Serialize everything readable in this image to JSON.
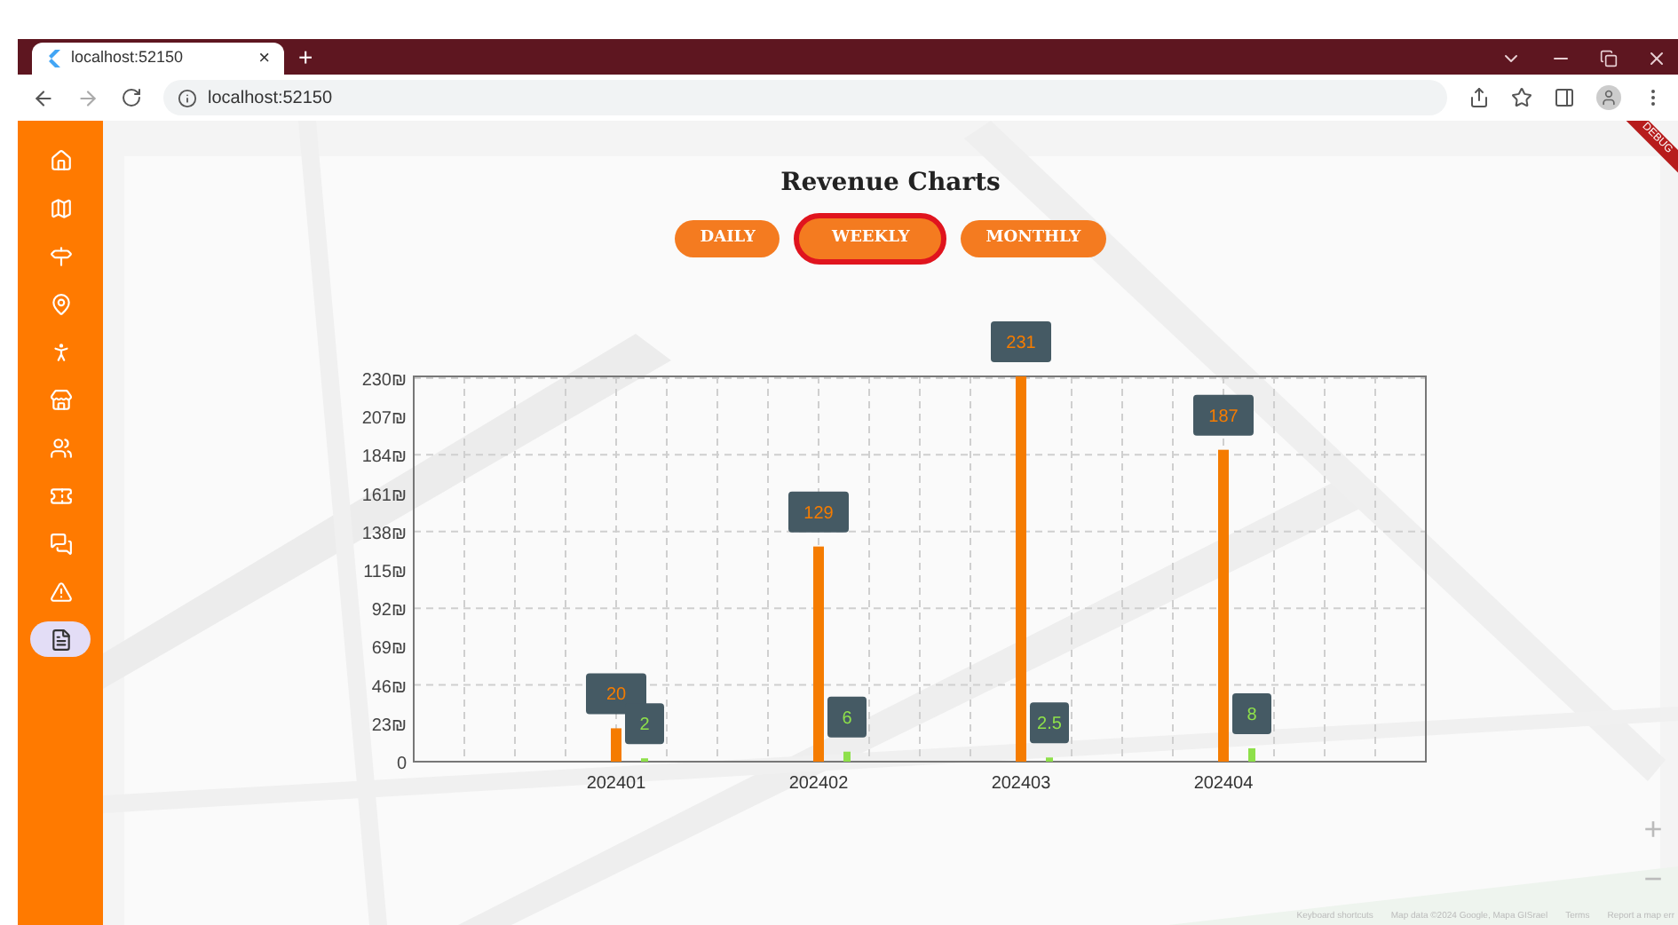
{
  "browser": {
    "tab": {
      "title": "localhost:52150",
      "close": "×"
    },
    "new_tab": "+",
    "address": "localhost:52150"
  },
  "sidebar": {
    "items": [
      {
        "kind": "home",
        "selected": false
      },
      {
        "kind": "map",
        "selected": false
      },
      {
        "kind": "route",
        "selected": false
      },
      {
        "kind": "pin",
        "selected": false
      },
      {
        "kind": "person",
        "selected": false
      },
      {
        "kind": "store",
        "selected": false
      },
      {
        "kind": "group",
        "selected": false
      },
      {
        "kind": "ticket",
        "selected": false
      },
      {
        "kind": "chat",
        "selected": false
      },
      {
        "kind": "alert",
        "selected": false
      },
      {
        "kind": "invoice",
        "selected": true
      }
    ]
  },
  "debug_banner": "DEBUG",
  "page": {
    "title": "Revenue Charts",
    "tabs": [
      {
        "label": "DAILY",
        "selected": false
      },
      {
        "label": "WEEKLY",
        "selected": true
      },
      {
        "label": "MONTHLY",
        "selected": false
      }
    ],
    "chart_data": {
      "type": "bar",
      "categories": [
        "202401",
        "202402",
        "202403",
        "202404"
      ],
      "series": [
        {
          "color": "#f57c00",
          "values": [
            20,
            129,
            231,
            187
          ]
        },
        {
          "color": "#8ee04a",
          "values": [
            2,
            6,
            2.5,
            8
          ]
        }
      ],
      "ylim": [
        0,
        231
      ],
      "grid": true,
      "yticks": [
        {
          "value": 0,
          "label": "0"
        },
        {
          "value": 23,
          "label": "23₪"
        },
        {
          "value": 46,
          "label": "46₪"
        },
        {
          "value": 69,
          "label": "69₪"
        },
        {
          "value": 92,
          "label": "92₪"
        },
        {
          "value": 115,
          "label": "115₪"
        },
        {
          "value": 138,
          "label": "138₪"
        },
        {
          "value": 161,
          "label": "161₪"
        },
        {
          "value": 184,
          "label": "184₪"
        },
        {
          "value": 207,
          "label": "207₪"
        },
        {
          "value": 230,
          "label": "230₪"
        }
      ],
      "data_labels": true
    }
  },
  "map_controls": {
    "zoom_in": "+",
    "zoom_out": "−"
  },
  "map_attribution": [
    "Keyboard shortcuts",
    "Map data ©2024 Google, Mapa GISrael",
    "Terms",
    "Report a map err"
  ]
}
